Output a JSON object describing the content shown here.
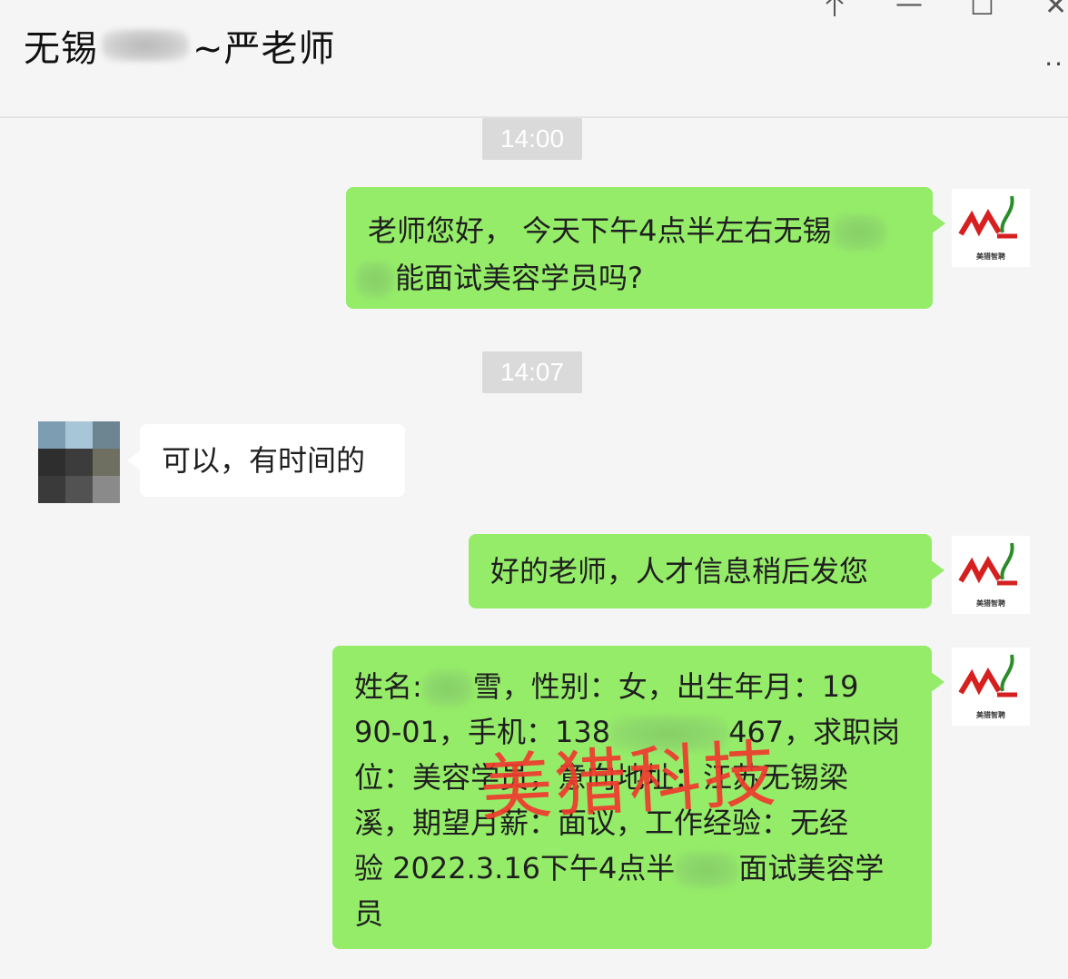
{
  "window": {
    "title_prefix": "无锡",
    "title_suffix": "~严老师",
    "pin_icon": "pin-icon",
    "minimize_glyph": "—",
    "maximize_glyph": "☐",
    "close_glyph": "✕",
    "more_glyph": "··"
  },
  "messages": [
    {
      "type": "timestamp",
      "text": "14:00"
    },
    {
      "type": "sent",
      "line1": "老师您好， 今天下午4点半左右无锡",
      "line2": "能面试美容学员吗?"
    },
    {
      "type": "timestamp",
      "text": "14:07"
    },
    {
      "type": "received",
      "text": "可以，有时间的"
    },
    {
      "type": "sent",
      "text": "好的老师，人才信息稍后发您"
    },
    {
      "type": "sent",
      "l1a": "姓名:",
      "l1b": "雪，性别：女，出生年月：19",
      "l2a": "90-01，手机：138",
      "l2b": "467，求职岗",
      "l3": "位：美容学员，意向地址：江苏无锡梁",
      "l4": "溪，期望月薪：面议，工作经验：无经",
      "l5a": "验 2022.3.16下午4点半",
      "l5b": "面试美容学",
      "l6": "员"
    }
  ],
  "avatar_me": {
    "logo_caption": "美猎智聘"
  },
  "watermark": "美猎科技",
  "colors": {
    "sent_bubble": "#95ec69",
    "received_bubble": "#ffffff",
    "background": "#f5f5f5",
    "watermark": "#f03a2e"
  }
}
